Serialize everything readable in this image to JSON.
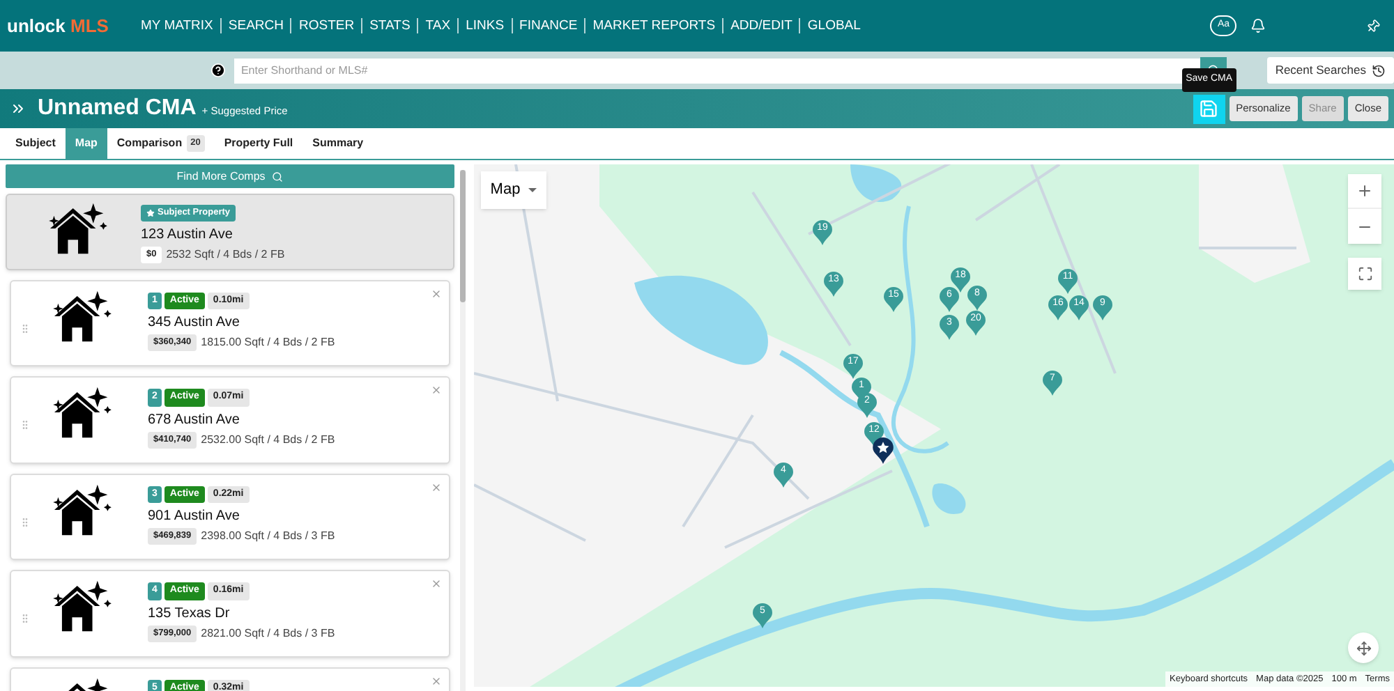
{
  "header": {
    "logo": {
      "text": "unlock",
      "accent": "MLS"
    },
    "nav": [
      "MY MATRIX",
      "SEARCH",
      "ROSTER",
      "STATS",
      "TAX",
      "LINKS",
      "FINANCE",
      "MARKET REPORTS",
      "ADD/EDIT",
      "GLOBAL"
    ],
    "font_button": "Aa"
  },
  "search_bar": {
    "placeholder": "Enter Shorthand or MLS#",
    "recent_searches": "Recent Searches"
  },
  "title_bar": {
    "title": "Unnamed CMA",
    "subtitle": "+ Suggested Price",
    "tooltip": "Save CMA",
    "buttons": [
      {
        "label": "Personalize",
        "disabled": false
      },
      {
        "label": "Share",
        "disabled": true
      },
      {
        "label": "Close",
        "disabled": false
      }
    ]
  },
  "tabs": [
    {
      "label": "Subject",
      "selected": false
    },
    {
      "label": "Map",
      "selected": true
    },
    {
      "label": "Comparison",
      "count": "20",
      "selected": false
    },
    {
      "label": "Property Full",
      "selected": false
    },
    {
      "label": "Summary",
      "selected": false
    }
  ],
  "find_more": "Find More Comps",
  "subject": {
    "badge": "Subject Property",
    "address": "123 Austin Ave",
    "price": "$0",
    "details": "2532 Sqft / 4 Bds / 2 FB"
  },
  "comps": [
    {
      "number": "1",
      "status": "Active",
      "distance": "0.10mi",
      "address": "345 Austin Ave",
      "price": "$360,340",
      "details": "1815.00 Sqft / 4 Bds / 2 FB"
    },
    {
      "number": "2",
      "status": "Active",
      "distance": "0.07mi",
      "address": "678 Austin Ave",
      "price": "$410,740",
      "details": "2532.00 Sqft / 4 Bds / 2 FB"
    },
    {
      "number": "3",
      "status": "Active",
      "distance": "0.22mi",
      "address": "901 Austin Ave",
      "price": "$469,839",
      "details": "2398.00 Sqft / 4 Bds / 3 FB"
    },
    {
      "number": "4",
      "status": "Active",
      "distance": "0.16mi",
      "address": "135 Texas Dr",
      "price": "$799,000",
      "details": "2821.00 Sqft / 4 Bds / 3 FB"
    },
    {
      "number": "5",
      "status": "Active",
      "distance": "0.32mi"
    }
  ],
  "map": {
    "type_control": "Map",
    "markers": [
      {
        "label": "1"
      },
      {
        "label": "2"
      },
      {
        "label": "3"
      },
      {
        "label": "4"
      },
      {
        "label": "5"
      },
      {
        "label": "6"
      },
      {
        "label": "7"
      },
      {
        "label": "8"
      },
      {
        "label": "9"
      },
      {
        "label": "11"
      },
      {
        "label": "12"
      },
      {
        "label": "13"
      },
      {
        "label": "14"
      },
      {
        "label": "15"
      },
      {
        "label": "16"
      },
      {
        "label": "17"
      },
      {
        "label": "18"
      },
      {
        "label": "19"
      },
      {
        "label": "20"
      }
    ],
    "footer": [
      "Keyboard shortcuts",
      "Map data ©2025",
      "100 m",
      "Terms"
    ]
  }
}
